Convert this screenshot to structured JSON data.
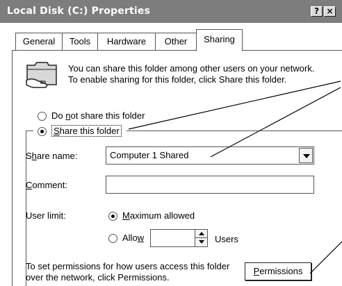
{
  "window": {
    "title": "Local Disk (C:) Properties",
    "help_label": "?",
    "close_label": "×"
  },
  "tabs": [
    {
      "label": "General"
    },
    {
      "label": "Tools"
    },
    {
      "label": "Hardware"
    },
    {
      "label": "Other"
    },
    {
      "label": "Sharing",
      "active": true
    }
  ],
  "info": {
    "text": "You can share this folder among other users on your network.  To enable sharing for this folder, click Share this folder."
  },
  "share_options": {
    "do_not_share": {
      "pre": "Do ",
      "u": "n",
      "post": "ot share this folder"
    },
    "share_this": {
      "pre": "",
      "u": "S",
      "post": "hare this folder"
    }
  },
  "share_name": {
    "label_pre": "S",
    "label_u": "h",
    "label_post": "are name:",
    "value": "Computer 1 Shared"
  },
  "comment": {
    "label_pre": "",
    "label_u": "C",
    "label_post": "omment:",
    "value": ""
  },
  "user_limit": {
    "label": "User limit:",
    "max_pre": "",
    "max_u": "M",
    "max_post": "aximum allowed",
    "allow_pre": "Allo",
    "allow_u": "w",
    "allow_post": "",
    "users_label": "Users",
    "allow_value": ""
  },
  "permissions": {
    "text": "To set permissions for how users access this folder over the network, click Permissions.",
    "button_pre": "",
    "button_u": "P",
    "button_post": "ermissions"
  }
}
